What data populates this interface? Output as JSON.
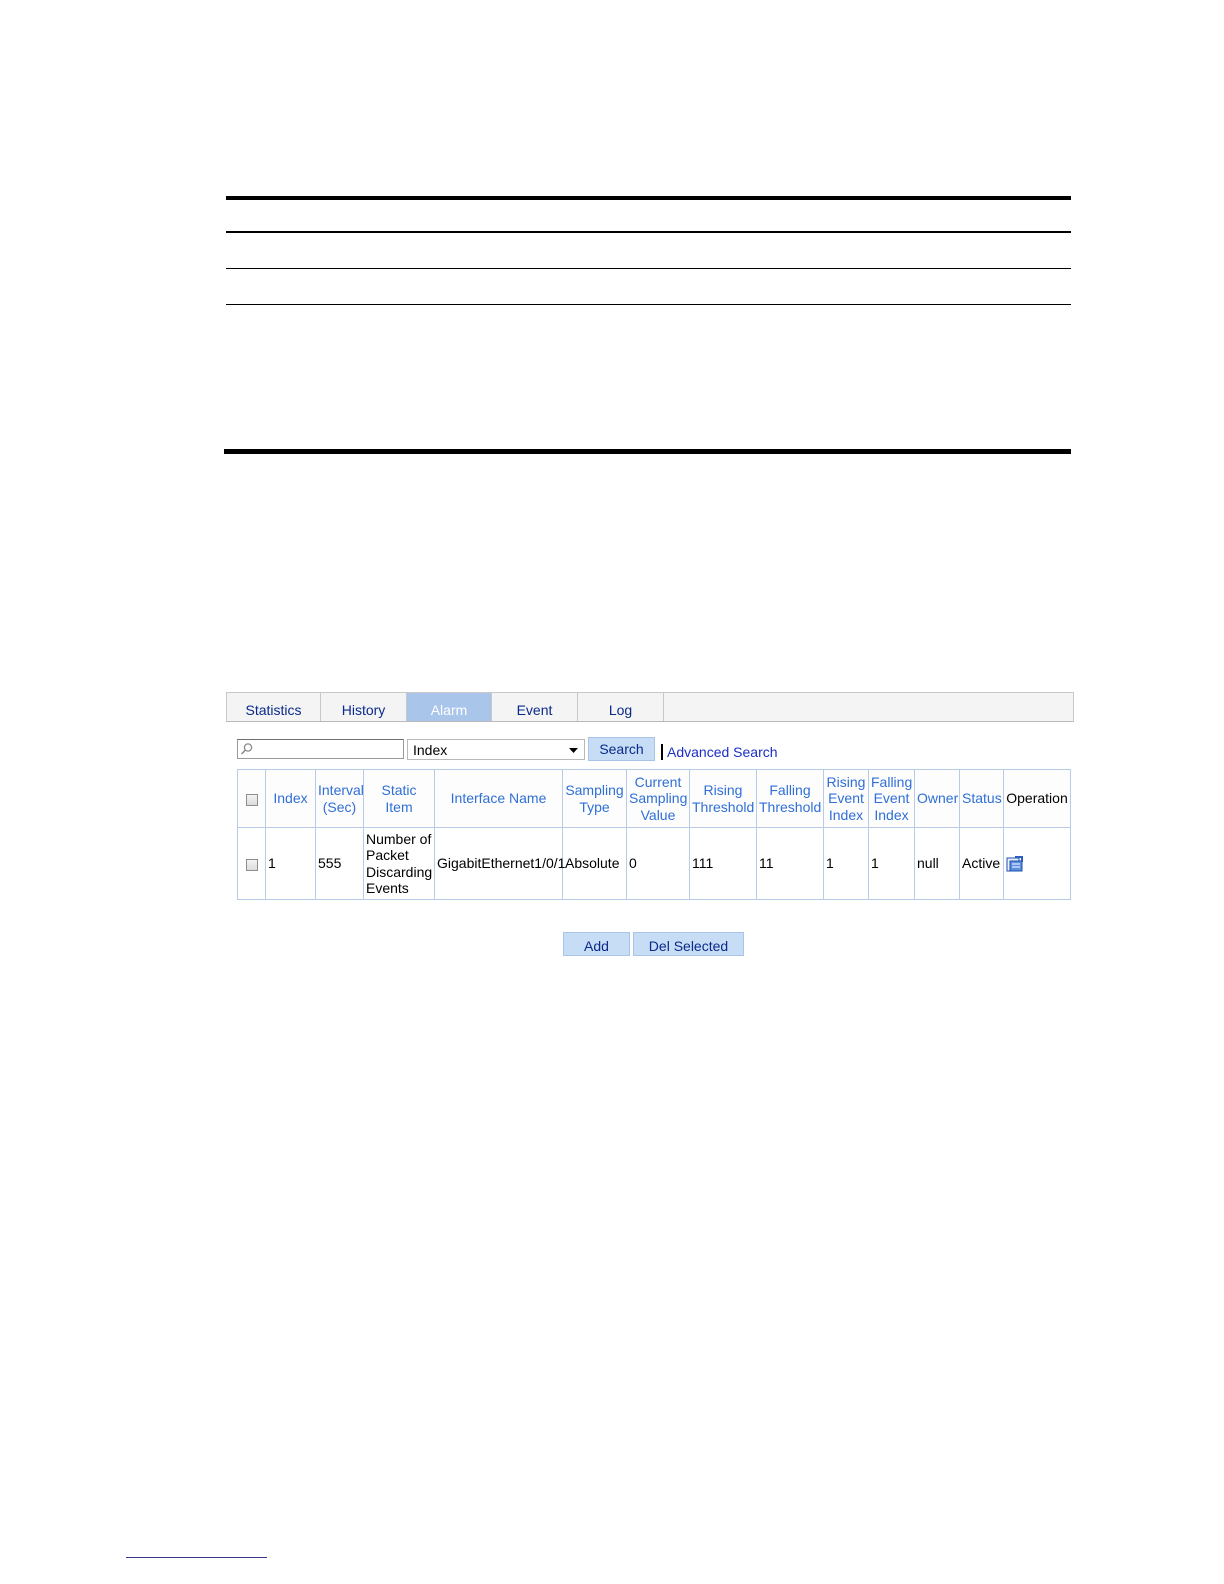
{
  "tabs": [
    {
      "label": "Statistics",
      "active": false
    },
    {
      "label": "History",
      "active": false
    },
    {
      "label": "Alarm",
      "active": true
    },
    {
      "label": "Event",
      "active": false
    },
    {
      "label": "Log",
      "active": false
    }
  ],
  "search": {
    "input_value": "",
    "field_selected": "Index",
    "search_label": "Search",
    "advanced_label": "Advanced Search"
  },
  "table": {
    "headers": {
      "index": "Index",
      "interval": "Interval (Sec)",
      "static_item": "Static Item",
      "interface": "Interface Name",
      "sampling_type": "Sampling Type",
      "current_value": "Current Sampling Value",
      "rising_threshold": "Rising Threshold",
      "falling_threshold": "Falling Threshold",
      "rising_event": "Rising Event Index",
      "falling_event": "Falling Event Index",
      "owner": "Owner",
      "status": "Status",
      "operation": "Operation"
    },
    "rows": [
      {
        "index": "1",
        "interval": "555",
        "static_item": "Number of Packet Discarding Events",
        "interface": "GigabitEthernet1/0/1",
        "sampling_type": "Absolute",
        "current_value": "0",
        "rising_threshold": "111",
        "falling_threshold": "11",
        "rising_event": "1",
        "falling_event": "1",
        "owner": "null",
        "status": "Active",
        "operation_icon": "edit-icon"
      }
    ]
  },
  "actions": {
    "add_label": "Add",
    "del_label": "Del Selected"
  },
  "colors": {
    "accent_blue": "#2f6fd6",
    "active_tab": "#a9c5ea",
    "button_bg": "#c7dcf5",
    "link": "#1a2fc8"
  }
}
